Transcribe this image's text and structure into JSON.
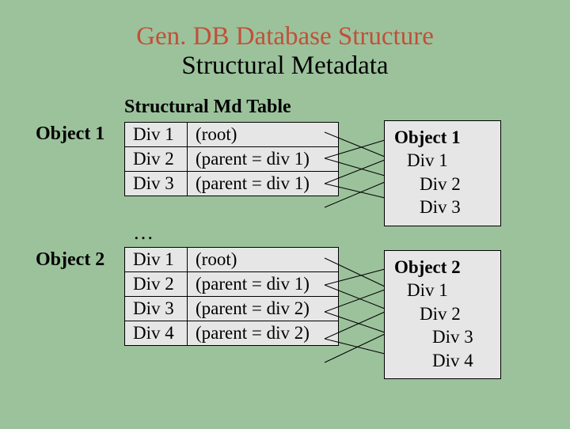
{
  "title": {
    "line1": "Gen. DB Database Structure",
    "line2": "Structural Metadata"
  },
  "table_header": "Structural Md Table",
  "label_object1": "Object 1",
  "label_object2": "Object 2",
  "table1": {
    "rows": [
      {
        "div": "Div 1",
        "note": "(root)"
      },
      {
        "div": "Div 2",
        "note": "(parent = div 1)"
      },
      {
        "div": "Div 3",
        "note": "(parent = div 1)"
      }
    ]
  },
  "ellipsis": "…",
  "table2": {
    "rows": [
      {
        "div": "Div 1",
        "note": "(root)"
      },
      {
        "div": "Div 2",
        "note": "(parent = div 1)"
      },
      {
        "div": "Div 3",
        "note": "(parent = div 2)"
      },
      {
        "div": "Div 4",
        "note": "(parent = div 2)"
      }
    ]
  },
  "tree1": {
    "title": "Object 1",
    "l1": "Div 1",
    "l2": "Div 2",
    "l3": "Div 3"
  },
  "tree2": {
    "title": "Object 2",
    "l1": "Div 1",
    "l2": "Div 2",
    "l3": "Div 3",
    "l4": "Div 4"
  }
}
